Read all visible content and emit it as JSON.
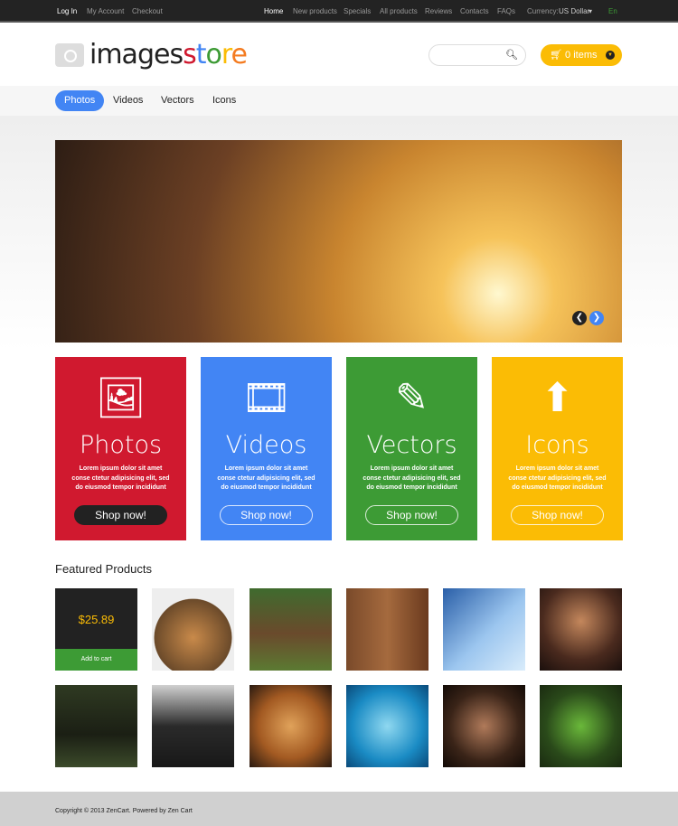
{
  "topbar": {
    "left": [
      "Log In",
      "My Account",
      "Checkout"
    ],
    "right": [
      "Home",
      "New products",
      "Specials",
      "All products",
      "Reviews",
      "Contacts",
      "FAQs"
    ],
    "currency_label": "Currency:",
    "currency_value": "US Dollar",
    "language": "En"
  },
  "logo": {
    "part1": "images",
    "s": "s",
    "t": "t",
    "o": "o",
    "r": "r",
    "e": "e"
  },
  "search": {
    "placeholder": ""
  },
  "cart": {
    "label": "0 items"
  },
  "nav": [
    "Photos",
    "Videos",
    "Vectors",
    "Icons"
  ],
  "tiles": [
    {
      "title": "Photos",
      "text": "Lorem ipsum dolor sit amet conse ctetur adipisicing elit, sed do eiusmod tempor incididunt",
      "button": "Shop now!",
      "color": "#d0192f",
      "icon": "image-icon"
    },
    {
      "title": "Videos",
      "text": "Lorem ipsum dolor sit amet conse ctetur adipisicing elit, sed do eiusmod tempor incididunt",
      "button": "Shop now!",
      "color": "#4285f4",
      "icon": "film-icon"
    },
    {
      "title": "Vectors",
      "text": "Lorem ipsum dolor sit amet conse ctetur adipisicing elit, sed do eiusmod tempor incididunt",
      "button": "Shop now!",
      "color": "#3d9b35",
      "icon": "pencil-icon"
    },
    {
      "title": "Icons",
      "text": "Lorem ipsum dolor sit amet conse ctetur adipisicing elit, sed do eiusmod tempor incididunt",
      "button": "Shop now!",
      "color": "#fbbc05",
      "icon": "upload-icon"
    }
  ],
  "featured": {
    "title": "Featured Products",
    "first_price": "$25.89",
    "add_to_cart": "Add to cart"
  },
  "footer": {
    "text": "Copyright © 2013 ZenCart. Powered by Zen Cart"
  }
}
